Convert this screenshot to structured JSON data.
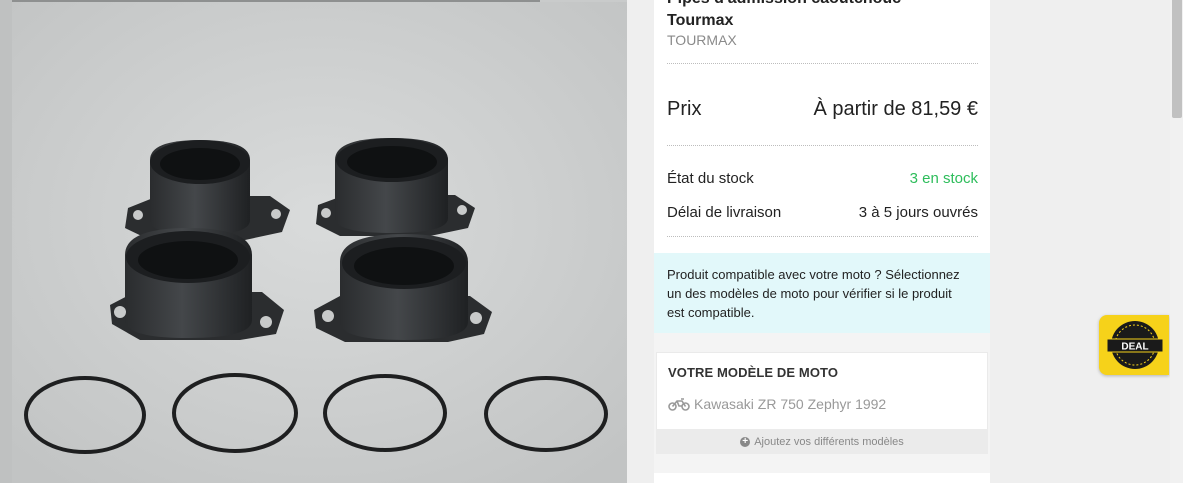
{
  "product": {
    "title_line_1": "Pipes d'admission caoutchouc",
    "title_line_2": "Tourmax",
    "brand": "TOURMAX",
    "image_alt": "Pipes d'admission caoutchouc Tourmax"
  },
  "pricing": {
    "label": "Prix",
    "value": "À partir de 81,59 €"
  },
  "stock": {
    "label": "État du stock",
    "value": "3 en stock",
    "value_color": "#2dbd5b"
  },
  "delivery": {
    "label": "Délai de livraison",
    "value": "3 à 5 jours ouvrés"
  },
  "compatibility": {
    "message": "Produit compatible avec votre moto ? Sélectionnez un des modèles de moto pour vérifier si le produit est compatible."
  },
  "moto_model": {
    "heading": "VOTRE MODÈLE DE MOTO",
    "selected": "Kawasaki ZR 750 Zephyr 1992",
    "icon": "motorcycle-icon",
    "add_label": "Ajoutez vos différents modèles"
  },
  "deal_badge": {
    "label": "DEAL",
    "background": "#f6d21a"
  }
}
